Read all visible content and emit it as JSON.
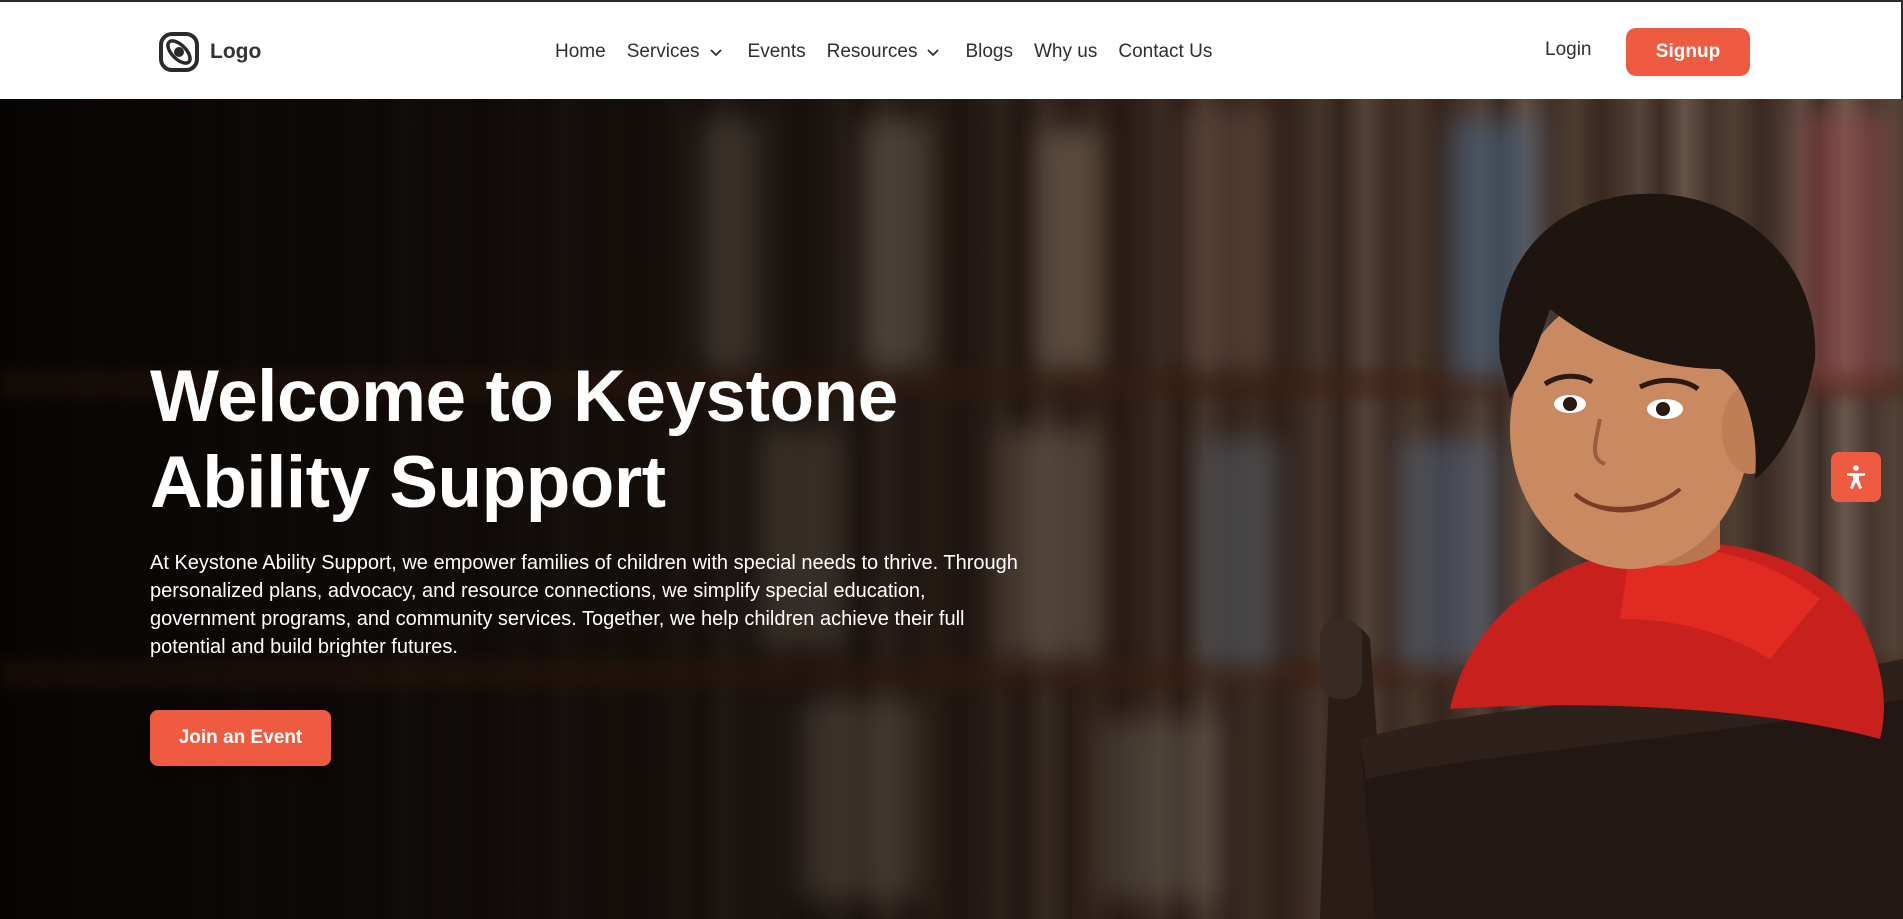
{
  "header": {
    "logo_text": "Logo",
    "nav": [
      {
        "label": "Home",
        "has_submenu": false
      },
      {
        "label": "Services",
        "has_submenu": true
      },
      {
        "label": "Events",
        "has_submenu": false
      },
      {
        "label": "Resources",
        "has_submenu": true
      },
      {
        "label": "Blogs",
        "has_submenu": false
      },
      {
        "label": "Why us",
        "has_submenu": false
      },
      {
        "label": "Contact Us",
        "has_submenu": false
      }
    ],
    "login_label": "Login",
    "signup_label": "Signup"
  },
  "hero": {
    "title": "Welcome to Keystone Ability Support",
    "description": "At Keystone Ability Support, we empower families of children with special needs to thrive. Through personalized plans, advocacy, and resource connections, we simplify special education, government programs, and community services. Together, we help children achieve their full potential and build brighter futures.",
    "cta_label": "Join an Event"
  },
  "icons": {
    "logo": "logo-icon",
    "chevron": "chevron-down-icon",
    "accessibility": "accessibility-icon"
  },
  "colors": {
    "accent": "#ef5b40",
    "nav_text": "#2f2f2f",
    "hero_text": "#ffffff"
  }
}
